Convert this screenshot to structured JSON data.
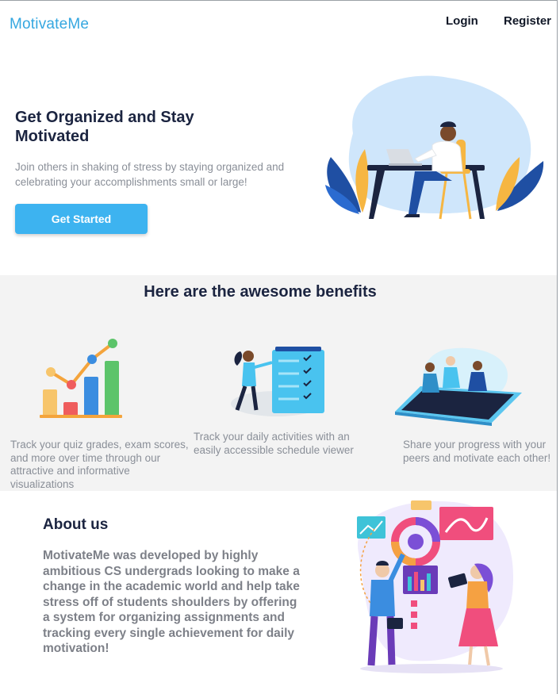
{
  "nav": {
    "brand": "MotivateMe",
    "login": "Login",
    "register": "Register"
  },
  "hero": {
    "title": "Get Organized and Stay Motivated",
    "subtitle": "Join others in shaking of stress by staying organized and celebrating your accomplishments small or large!",
    "cta_label": "Get Started",
    "illustration": "person-working-at-desk-illustration"
  },
  "benefits": {
    "title": "Here are the awesome benefits",
    "items": [
      {
        "icon": "growth-chart-icon",
        "text": "Track your quiz grades, exam scores, and more over time through our attractive and informative visualizations"
      },
      {
        "icon": "schedule-checklist-icon",
        "text": "Track your daily activities with an easily accessible schedule viewer"
      },
      {
        "icon": "people-on-phone-icon",
        "text": "Share your progress with your peers and motivate each other!"
      }
    ]
  },
  "about": {
    "title": "About us",
    "text": "MotivateMe was developed by highly ambitious CS undergrads looking to make a change in the academic world and help take stress off of students shoulders by offering a system for organizing assignments and tracking every single achievement for daily motivation!",
    "illustration": "team-analytics-illustration"
  },
  "colors": {
    "brand": "#35a7e0",
    "cta": "#3db3f0",
    "heading": "#1b2440",
    "muted_text": "#8a8f98",
    "band_background": "#f3f3f3"
  }
}
